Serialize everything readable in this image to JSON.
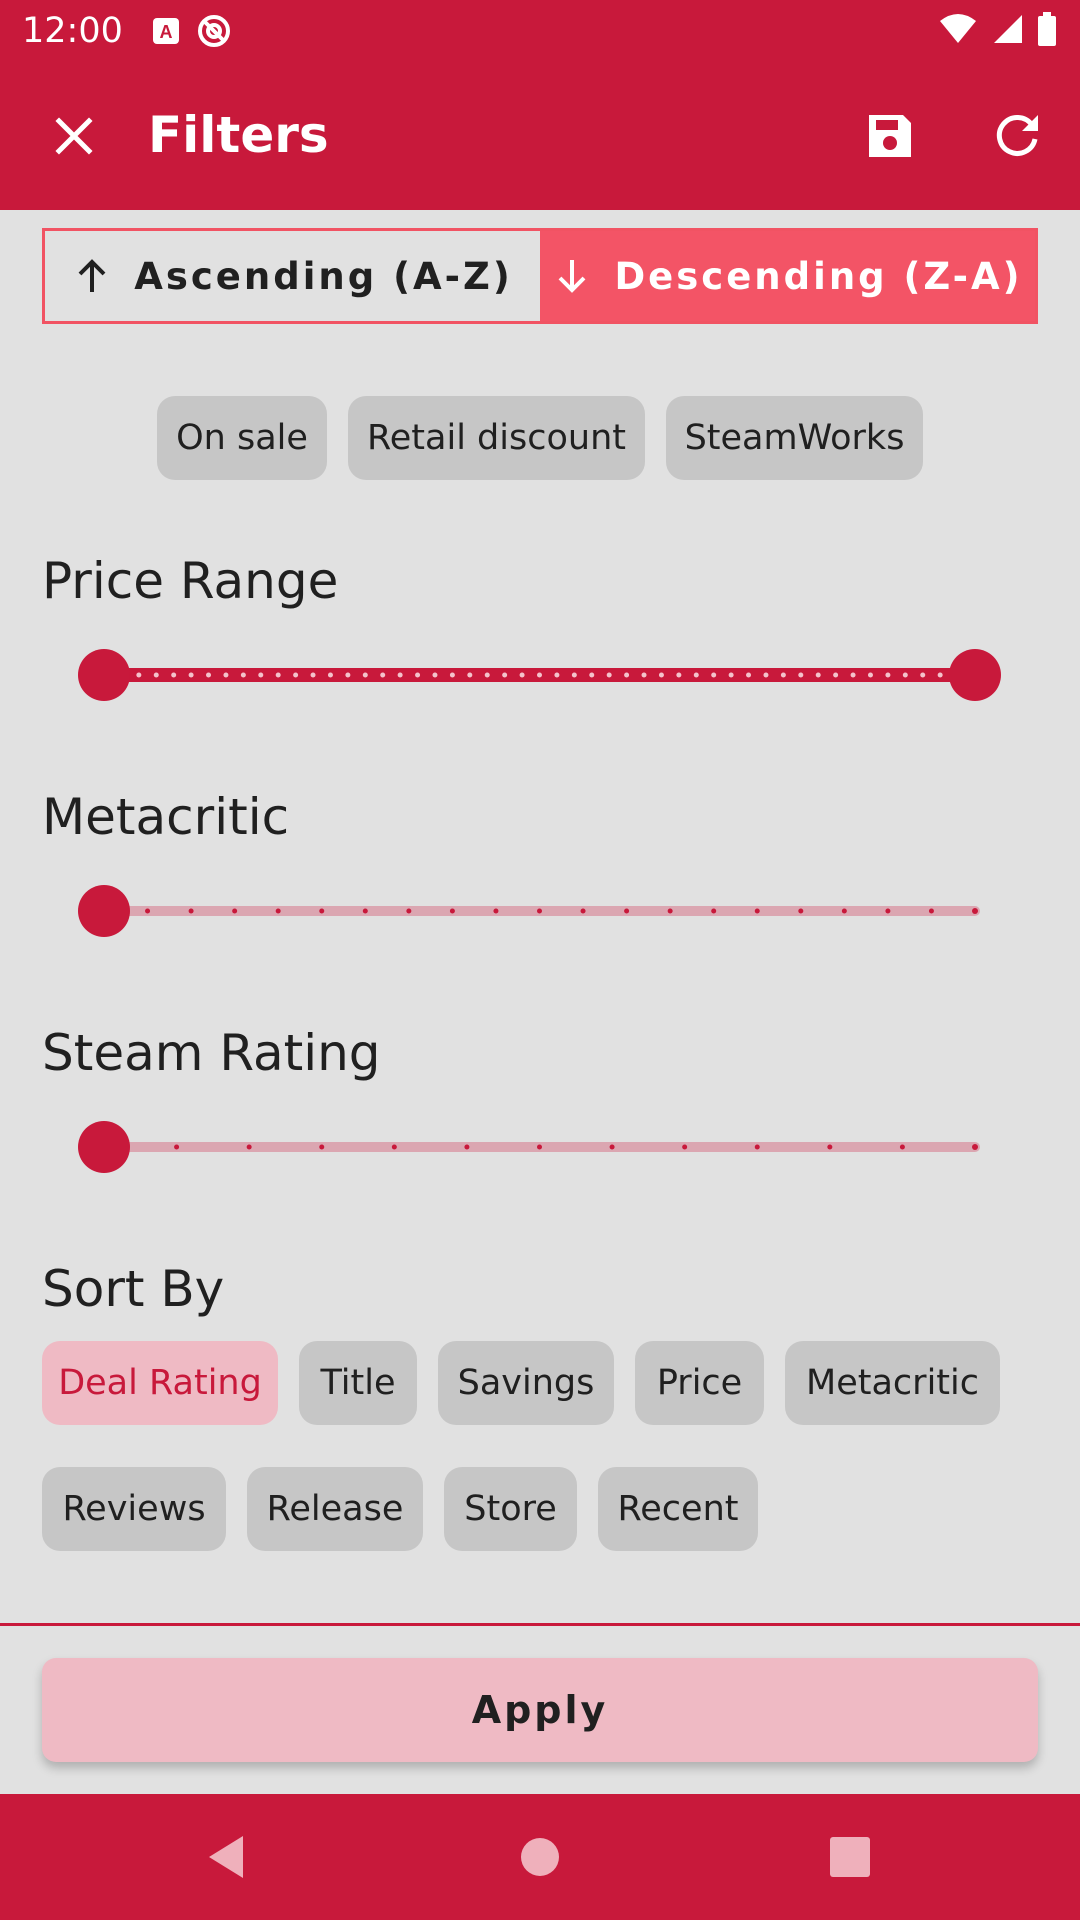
{
  "status_bar": {
    "time": "12:00",
    "icons": [
      "a-box-icon",
      "at-sign-icon",
      "wifi-icon",
      "signal-icon",
      "battery-icon"
    ]
  },
  "app_bar": {
    "title": "Filters",
    "close_icon": "close-icon",
    "save_icon": "save-icon",
    "refresh_icon": "refresh-icon"
  },
  "sort_order": {
    "ascending_label": "Ascending (A-Z)",
    "descending_label": "Descending (Z-A)",
    "selected": "descending"
  },
  "filter_chips": [
    "On sale",
    "Retail discount",
    "SteamWorks"
  ],
  "sliders": {
    "price_range": {
      "label": "Price Range",
      "start_fraction": 0.0,
      "end_fraction": 1.0,
      "steps": 50
    },
    "metacritic": {
      "label": "Metacritic",
      "value_fraction": 0.0,
      "steps": 20
    },
    "steam_rating": {
      "label": "Steam Rating",
      "value_fraction": 0.0,
      "steps": 12
    }
  },
  "sort_by": {
    "label": "Sort By",
    "options": [
      "Deal Rating",
      "Title",
      "Savings",
      "Price",
      "Metacritic",
      "Reviews",
      "Release",
      "Store",
      "Recent"
    ],
    "selected": "Deal Rating"
  },
  "apply_label": "Apply",
  "colors": {
    "primary": "#c8193b",
    "accent": "#f35466",
    "chip_selected_bg": "#efbac4",
    "chip_bg": "#c6c6c6",
    "background": "#e1e1e1"
  }
}
